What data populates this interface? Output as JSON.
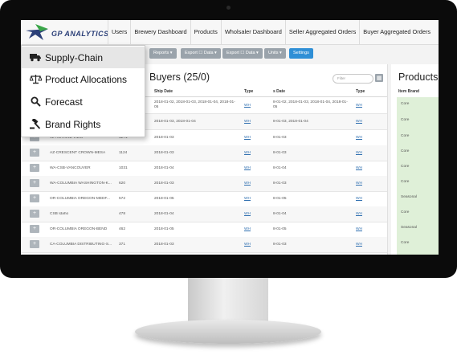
{
  "brand": {
    "logo_text": "GP ANALYTICS",
    "accent": "#2f8fd6",
    "dropdown_highlight": "#e6e6e6",
    "products_highlight": "#dff0d8"
  },
  "topnav": {
    "items": [
      "Users",
      "Brewery Dashboard",
      "Products",
      "Wholsaler Dashboard",
      "Seller Aggregated Orders",
      "Buyer Aggregated Orders"
    ]
  },
  "toolbar": {
    "buttons": [
      "Reports ▾",
      "Export ☐ Data ▾",
      "Export ☐ Data ▾",
      "Units ▾",
      "Settings"
    ]
  },
  "dropdown": {
    "items": [
      {
        "label": "Supply-Chain",
        "icon": "truck-icon",
        "active": true
      },
      {
        "label": "Product Allocations",
        "icon": "scale-icon",
        "active": false
      },
      {
        "label": "Forecast",
        "icon": "search-icon",
        "active": false
      },
      {
        "label": "Brand Rights",
        "icon": "gavel-icon",
        "active": false
      }
    ]
  },
  "buyers": {
    "title": "Buyers (25/0)",
    "filter_placeholder": "Filter",
    "columns": {
      "ship_date": "Ship Date",
      "type": "Type",
      "date2": "s Date",
      "type2": "Type"
    },
    "rows": [
      {
        "name": "",
        "qty": "",
        "ship": "2018-01-02, 2018-01-03, 2018-01-04, 2018-01-05",
        "type": "WH",
        "date2": "8-01-02, 2018-01-03, 2018-01-04, 2018-01-05",
        "type2": "WH"
      },
      {
        "name": "",
        "qty": "",
        "ship": "2018-01-03, 2018-01-04",
        "type": "WH",
        "date2": "8-01-03, 2018-01-04",
        "type2": "WH"
      },
      {
        "name": "WA-MARINE VIEW",
        "qty": "1271",
        "ship": "2018-01-03",
        "type": "WH",
        "date2": "8-01-03",
        "type2": "WH"
      },
      {
        "name": "AZ-CRESCENT CROWN-MESA",
        "qty": "1124",
        "ship": "2018-01-03",
        "type": "WH",
        "date2": "8-01-03",
        "type2": "WH"
      },
      {
        "name": "WA-CSB-VANCOUVER",
        "qty": "1031",
        "ship": "2018-01-04",
        "type": "WH",
        "date2": "8-01-04",
        "type2": "WH"
      },
      {
        "name": "WA-COLUMBIA WASHINGTON-K...",
        "qty": "620",
        "ship": "2018-01-03",
        "type": "WH",
        "date2": "8-01-03",
        "type2": "WH"
      },
      {
        "name": "OR-COLUMBIA OREGON-MEDF...",
        "qty": "572",
        "ship": "2018-01-05",
        "type": "WH",
        "date2": "8-01-05",
        "type2": "WH"
      },
      {
        "name": "CSB Idaho",
        "qty": "478",
        "ship": "2018-01-04",
        "type": "WH",
        "date2": "8-01-04",
        "type2": "WH"
      },
      {
        "name": "OR-COLUMBIA OREGON-BEND",
        "qty": "462",
        "ship": "2018-01-05",
        "type": "WH",
        "date2": "8-01-05",
        "type2": "WH"
      },
      {
        "name": "CA-COLUMBIA DISTRIBUTING-S...",
        "qty": "371",
        "ship": "2018-01-03",
        "type": "WH",
        "date2": "8-01-03",
        "type2": "WH"
      }
    ]
  },
  "products": {
    "title": "Products",
    "header": "Item Brand",
    "items": [
      "Core",
      "Core",
      "Core",
      "Core",
      "Core",
      "Core",
      "Seasonal",
      "Core",
      "Seasonal",
      "Core"
    ]
  }
}
